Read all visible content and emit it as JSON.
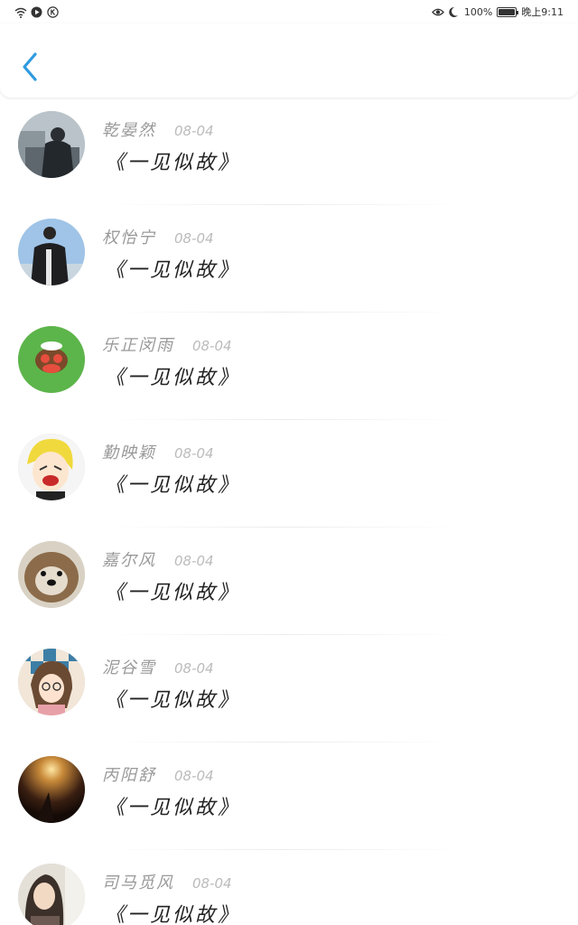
{
  "status_bar": {
    "left_icons": [
      "wifi-icon",
      "play-icon",
      "k-circle-icon"
    ],
    "right_icons": [
      "eye-icon",
      "moon-icon",
      "battery-icon"
    ],
    "battery": "100%",
    "time": "晚上9:11"
  },
  "header": {
    "back_icon": "chevron-left-icon",
    "accent_color": "#2f9be0"
  },
  "messages": [
    {
      "name": "乾晏然",
      "date": "08-04",
      "text": "《一见似故》",
      "avatar": "photo-man-dark"
    },
    {
      "name": "权怡宁",
      "date": "08-04",
      "text": "《一见似故》",
      "avatar": "photo-man-jacket"
    },
    {
      "name": "乐正闵雨",
      "date": "08-04",
      "text": "《一见似故》",
      "avatar": "monkey-green"
    },
    {
      "name": "勤映颖",
      "date": "08-04",
      "text": "《一见似故》",
      "avatar": "cartoon-yellow-hair"
    },
    {
      "name": "嘉尔风",
      "date": "08-04",
      "text": "《一见似故》",
      "avatar": "dog"
    },
    {
      "name": "泥谷雪",
      "date": "08-04",
      "text": "《一见似故》",
      "avatar": "cartoon-girl-glasses"
    },
    {
      "name": "丙阳舒",
      "date": "08-04",
      "text": "《一见似故》",
      "avatar": "sunset"
    },
    {
      "name": "司马觅风",
      "date": "08-04",
      "text": "《一见似故》",
      "avatar": "photo-girl"
    }
  ]
}
